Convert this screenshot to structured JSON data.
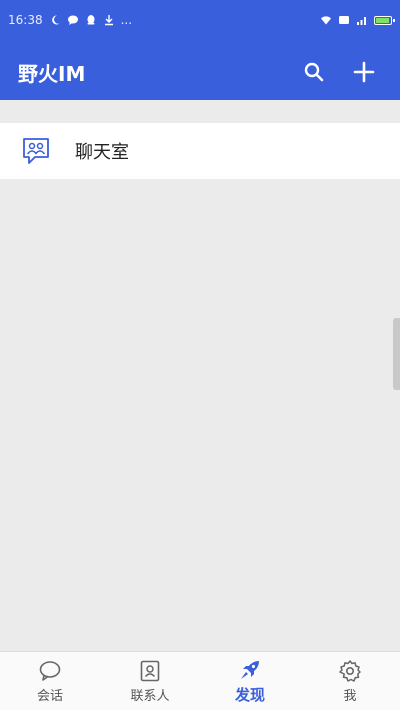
{
  "statusbar": {
    "time": "16:38",
    "more": "..."
  },
  "appbar": {
    "title": "野火IM",
    "search_icon": "search-icon",
    "add_icon": "plus-icon"
  },
  "discover": {
    "items": [
      {
        "label": "聊天室",
        "icon": "chatroom-icon"
      }
    ]
  },
  "tabbar": {
    "tabs": [
      {
        "label": "会话",
        "icon": "chat-bubble-icon",
        "active": false
      },
      {
        "label": "联系人",
        "icon": "contacts-icon",
        "active": false
      },
      {
        "label": "发现",
        "icon": "rocket-icon",
        "active": true
      },
      {
        "label": "我",
        "icon": "gear-icon",
        "active": false
      }
    ]
  },
  "colors": {
    "accent": "#3a5fdc",
    "background": "#ebebeb"
  }
}
